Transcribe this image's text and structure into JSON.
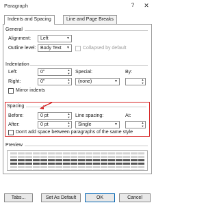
{
  "window": {
    "title": "Paragraph",
    "help_label": "?",
    "close_label": "✕"
  },
  "tabs": [
    {
      "label": "Indents and Spacing",
      "active": true
    },
    {
      "label": "Line and Page Breaks",
      "active": false
    }
  ],
  "general": {
    "heading": "General",
    "alignment_label": "Alignment:",
    "alignment_value": "Left",
    "outline_label": "Outline level:",
    "outline_value": "Body Text",
    "collapsed_label": "Collapsed by default"
  },
  "indentation": {
    "heading": "Indentation",
    "left_label": "Left:",
    "left_value": "0\"",
    "right_label": "Right:",
    "right_value": "0\"",
    "special_label": "Special:",
    "special_value": "(none)",
    "by_label": "By:",
    "by_value": "",
    "mirror_label": "Mirror indents"
  },
  "spacing": {
    "heading": "Spacing",
    "before_label": "Before:",
    "before_value": "0 pt",
    "after_label": "After:",
    "after_value": "0 pt",
    "line_spacing_label": "Line spacing:",
    "line_spacing_value": "Single",
    "at_label": "At:",
    "at_value": "",
    "dont_add_label": "Don't add space between paragraphs of the same style"
  },
  "preview": {
    "heading": "Preview"
  },
  "buttons": {
    "tabs": "Tabs...",
    "set_default": "Set As Default",
    "ok": "OK",
    "cancel": "Cancel"
  },
  "colors": {
    "highlight": "#d62020",
    "focus_border": "#0063b1"
  },
  "icons": {
    "dropdown": "chevron-down-icon",
    "spinner": "spinner-arrows-icon"
  }
}
